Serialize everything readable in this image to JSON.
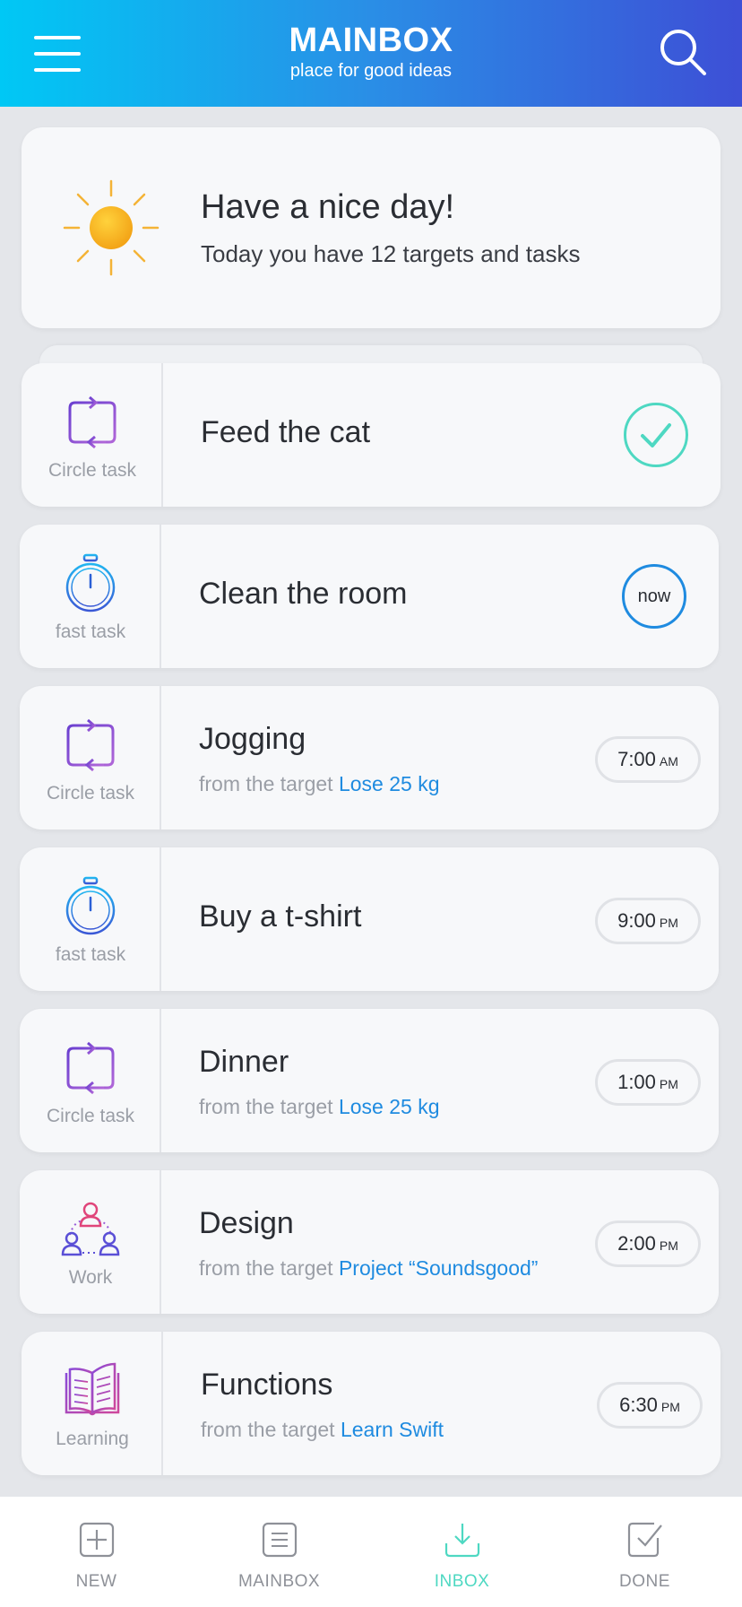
{
  "header": {
    "title": "MAINBOX",
    "subtitle": "place for good ideas"
  },
  "greeting": {
    "title": "Have a nice day!",
    "text": "Today you have 12 targets and tasks"
  },
  "tasks": [
    {
      "type": "Circle task",
      "title": "Feed the cat",
      "status": "done"
    },
    {
      "type": "fast task",
      "title": "Clean the room",
      "status_label": "now"
    },
    {
      "type": "Circle task",
      "title": "Jogging",
      "sub_prefix": "from the target ",
      "target": "Lose 25 kg",
      "time": "7:00",
      "ampm": "AM"
    },
    {
      "type": "fast task",
      "title": "Buy a t-shirt",
      "time": "9:00",
      "ampm": "PM"
    },
    {
      "type": "Circle task",
      "title": "Dinner",
      "sub_prefix": "from the target ",
      "target": "Lose 25 kg",
      "time": "1:00",
      "ampm": "PM"
    },
    {
      "type": "Work",
      "title": "Design",
      "sub_prefix": "from the target ",
      "target": "Project “Soundsgood”",
      "time": "2:00",
      "ampm": "PM"
    },
    {
      "type": "Learning",
      "title": "Functions",
      "sub_prefix": "from the target ",
      "target": "Learn Swift",
      "time": "6:30",
      "ampm": "PM"
    }
  ],
  "tabs": [
    {
      "label": "NEW",
      "icon": "plus-square-icon"
    },
    {
      "label": "MAINBOX",
      "icon": "list-square-icon"
    },
    {
      "label": "INBOX",
      "icon": "download-tray-icon",
      "active": true
    },
    {
      "label": "DONE",
      "icon": "checkbox-icon"
    }
  ],
  "colors": {
    "accent_teal": "#4ed8c2",
    "accent_blue": "#1f8be0",
    "header_start": "#00c8f5",
    "header_end": "#3d4fd6",
    "circle_icon": "#8a4bd8"
  }
}
